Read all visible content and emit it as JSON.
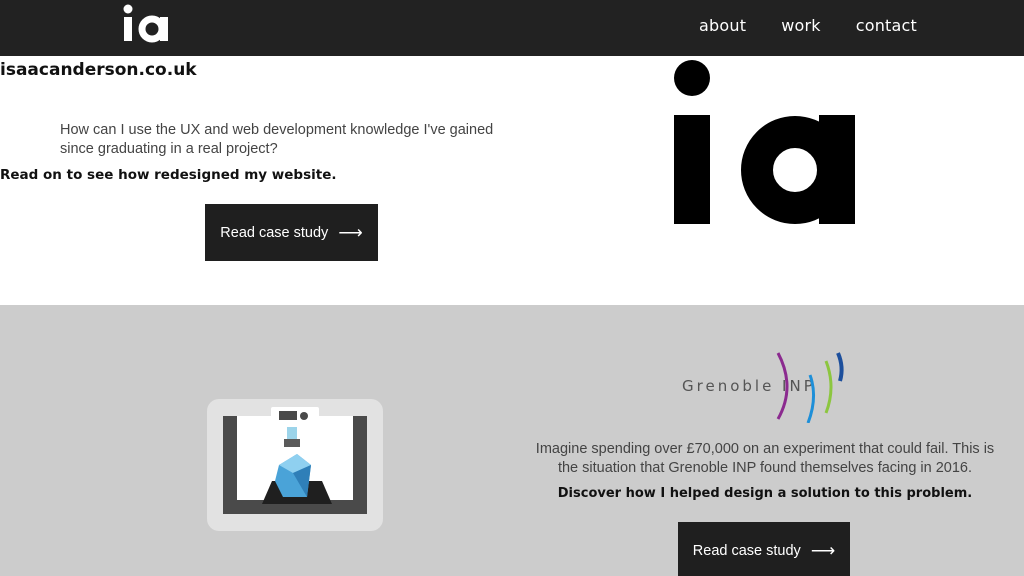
{
  "nav": {
    "logo_text": "ia",
    "links": [
      {
        "label": "about"
      },
      {
        "label": "work"
      },
      {
        "label": "contact"
      }
    ]
  },
  "hero": {
    "site_name": "isaacanderson.co.uk",
    "description": "How can I use the UX and web development knowledge I've gained since graduating in a real project?",
    "cta": "Read on to see how redesigned my website.",
    "button_label": "Read case study",
    "button_arrow": "⟶",
    "logo_text": "ia"
  },
  "project": {
    "partner_logo_text": "Grenoble INP",
    "description": "Imagine spending over £70,000 on an experiment that could fail. This is the situation that Grenoble INP found themselves facing in 2016.",
    "cta": "Discover how I helped design a solution to this problem.",
    "button_label": "Read case study",
    "button_arrow": "⟶"
  },
  "colors": {
    "nav_bg": "#222222",
    "section_bg": "#cccccc",
    "button_bg": "#1f1f1f",
    "grenoble_purple": "#8b2a8f",
    "grenoble_blue": "#1e8fd8",
    "grenoble_green": "#8cc63f",
    "grenoble_navy": "#1d4f9c"
  }
}
